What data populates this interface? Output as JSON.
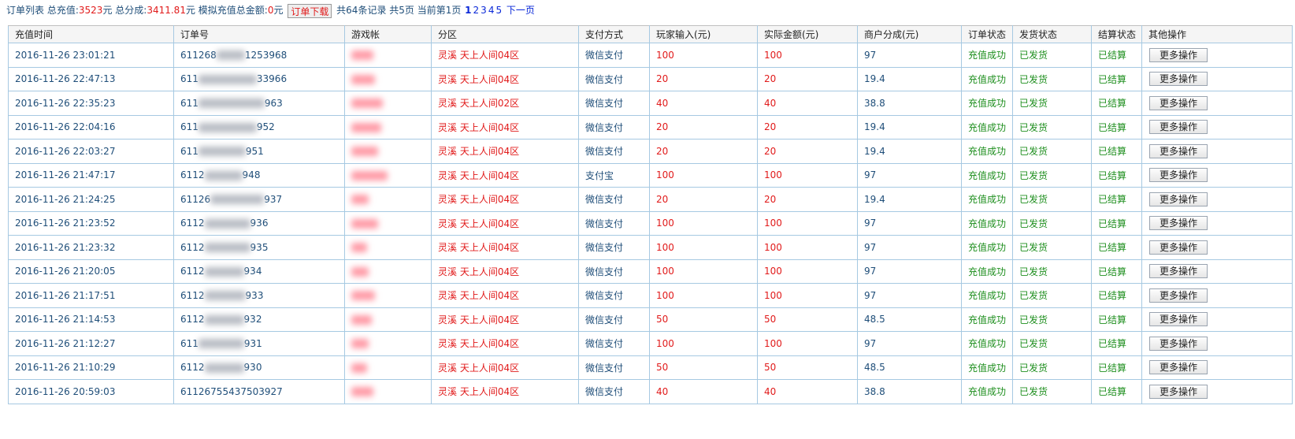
{
  "summary": {
    "list_label": "订单列表",
    "total_recharge_label": "总充值:",
    "total_recharge_value": "3523",
    "yuan1": "元",
    "total_share_label": "总分成:",
    "total_share_value": "3411.81",
    "yuan2": "元",
    "sim_label": "模拟充值总金额:",
    "sim_value": "0",
    "yuan3": "元",
    "download_button": "订单下载",
    "records_text": "共64条记录 共5页 当前第1页",
    "pages": [
      "1",
      "2",
      "3",
      "4",
      "5"
    ],
    "next_page": "下一页"
  },
  "table": {
    "headers": [
      "充值时间",
      "订单号",
      "游戏帐",
      "分区",
      "支付方式",
      "玩家输入(元)",
      "实际金额(元)",
      "商户分成(元)",
      "订单状态",
      "发货状态",
      "结算状态",
      "其他操作"
    ],
    "more_button": "更多操作",
    "rows": [
      {
        "time": "2016-11-26 23:01:21",
        "order_prefix": "611268",
        "order_suffix": "1253968",
        "zone": "灵溪 天上人间04区",
        "pay": "微信支付",
        "input": "100",
        "actual": "100",
        "share": "97",
        "order_status": "充值成功",
        "ship_status": "已发货",
        "settle_status": "已结算"
      },
      {
        "time": "2016-11-26 22:47:13",
        "order_prefix": "611",
        "order_suffix": "33966",
        "zone": "灵溪 天上人间04区",
        "pay": "微信支付",
        "input": "20",
        "actual": "20",
        "share": "19.4",
        "order_status": "充值成功",
        "ship_status": "已发货",
        "settle_status": "已结算"
      },
      {
        "time": "2016-11-26 22:35:23",
        "order_prefix": "611",
        "order_suffix": "963",
        "zone": "灵溪 天上人间02区",
        "pay": "微信支付",
        "input": "40",
        "actual": "40",
        "share": "38.8",
        "order_status": "充值成功",
        "ship_status": "已发货",
        "settle_status": "已结算"
      },
      {
        "time": "2016-11-26 22:04:16",
        "order_prefix": "611",
        "order_suffix": "952",
        "zone": "灵溪 天上人间04区",
        "pay": "微信支付",
        "input": "20",
        "actual": "20",
        "share": "19.4",
        "order_status": "充值成功",
        "ship_status": "已发货",
        "settle_status": "已结算"
      },
      {
        "time": "2016-11-26 22:03:27",
        "order_prefix": "611",
        "order_suffix": "951",
        "zone": "灵溪 天上人间04区",
        "pay": "微信支付",
        "input": "20",
        "actual": "20",
        "share": "19.4",
        "order_status": "充值成功",
        "ship_status": "已发货",
        "settle_status": "已结算"
      },
      {
        "time": "2016-11-26 21:47:17",
        "order_prefix": "6112",
        "order_suffix": "948",
        "zone": "灵溪 天上人间04区",
        "pay": "支付宝",
        "input": "100",
        "actual": "100",
        "share": "97",
        "order_status": "充值成功",
        "ship_status": "已发货",
        "settle_status": "已结算"
      },
      {
        "time": "2016-11-26 21:24:25",
        "order_prefix": "61126",
        "order_suffix": "937",
        "zone": "灵溪 天上人间04区",
        "pay": "微信支付",
        "input": "20",
        "actual": "20",
        "share": "19.4",
        "order_status": "充值成功",
        "ship_status": "已发货",
        "settle_status": "已结算"
      },
      {
        "time": "2016-11-26 21:23:52",
        "order_prefix": "6112",
        "order_suffix": "936",
        "zone": "灵溪 天上人间04区",
        "pay": "微信支付",
        "input": "100",
        "actual": "100",
        "share": "97",
        "order_status": "充值成功",
        "ship_status": "已发货",
        "settle_status": "已结算"
      },
      {
        "time": "2016-11-26 21:23:32",
        "order_prefix": "6112",
        "order_suffix": "935",
        "zone": "灵溪 天上人间04区",
        "pay": "微信支付",
        "input": "100",
        "actual": "100",
        "share": "97",
        "order_status": "充值成功",
        "ship_status": "已发货",
        "settle_status": "已结算"
      },
      {
        "time": "2016-11-26 21:20:05",
        "order_prefix": "6112",
        "order_suffix": "934",
        "zone": "灵溪 天上人间04区",
        "pay": "微信支付",
        "input": "100",
        "actual": "100",
        "share": "97",
        "order_status": "充值成功",
        "ship_status": "已发货",
        "settle_status": "已结算"
      },
      {
        "time": "2016-11-26 21:17:51",
        "order_prefix": "6112",
        "order_suffix": "933",
        "zone": "灵溪 天上人间04区",
        "pay": "微信支付",
        "input": "100",
        "actual": "100",
        "share": "97",
        "order_status": "充值成功",
        "ship_status": "已发货",
        "settle_status": "已结算"
      },
      {
        "time": "2016-11-26 21:14:53",
        "order_prefix": "6112",
        "order_suffix": "932",
        "zone": "灵溪 天上人间04区",
        "pay": "微信支付",
        "input": "50",
        "actual": "50",
        "share": "48.5",
        "order_status": "充值成功",
        "ship_status": "已发货",
        "settle_status": "已结算"
      },
      {
        "time": "2016-11-26 21:12:27",
        "order_prefix": "611",
        "order_suffix": "931",
        "zone": "灵溪 天上人间04区",
        "pay": "微信支付",
        "input": "100",
        "actual": "100",
        "share": "97",
        "order_status": "充值成功",
        "ship_status": "已发货",
        "settle_status": "已结算"
      },
      {
        "time": "2016-11-26 21:10:29",
        "order_prefix": "6112",
        "order_suffix": "930",
        "zone": "灵溪 天上人间04区",
        "pay": "微信支付",
        "input": "50",
        "actual": "50",
        "share": "48.5",
        "order_status": "充值成功",
        "ship_status": "已发货",
        "settle_status": "已结算"
      },
      {
        "time": "2016-11-26 20:59:03",
        "order_prefix": "6112675543750",
        "order_suffix": "3927",
        "zone": "灵溪 天上人间04区",
        "pay": "微信支付",
        "input": "40",
        "actual": "40",
        "share": "38.8",
        "order_status": "充值成功",
        "ship_status": "已发货",
        "settle_status": "已结算"
      }
    ]
  },
  "colors": {
    "accent_text": "#1f4e79",
    "amount_red": "#e11b1b",
    "status_green": "#1f8f1f",
    "page_link_blue": "#0a28d8",
    "table_border": "#a6c9e2"
  }
}
